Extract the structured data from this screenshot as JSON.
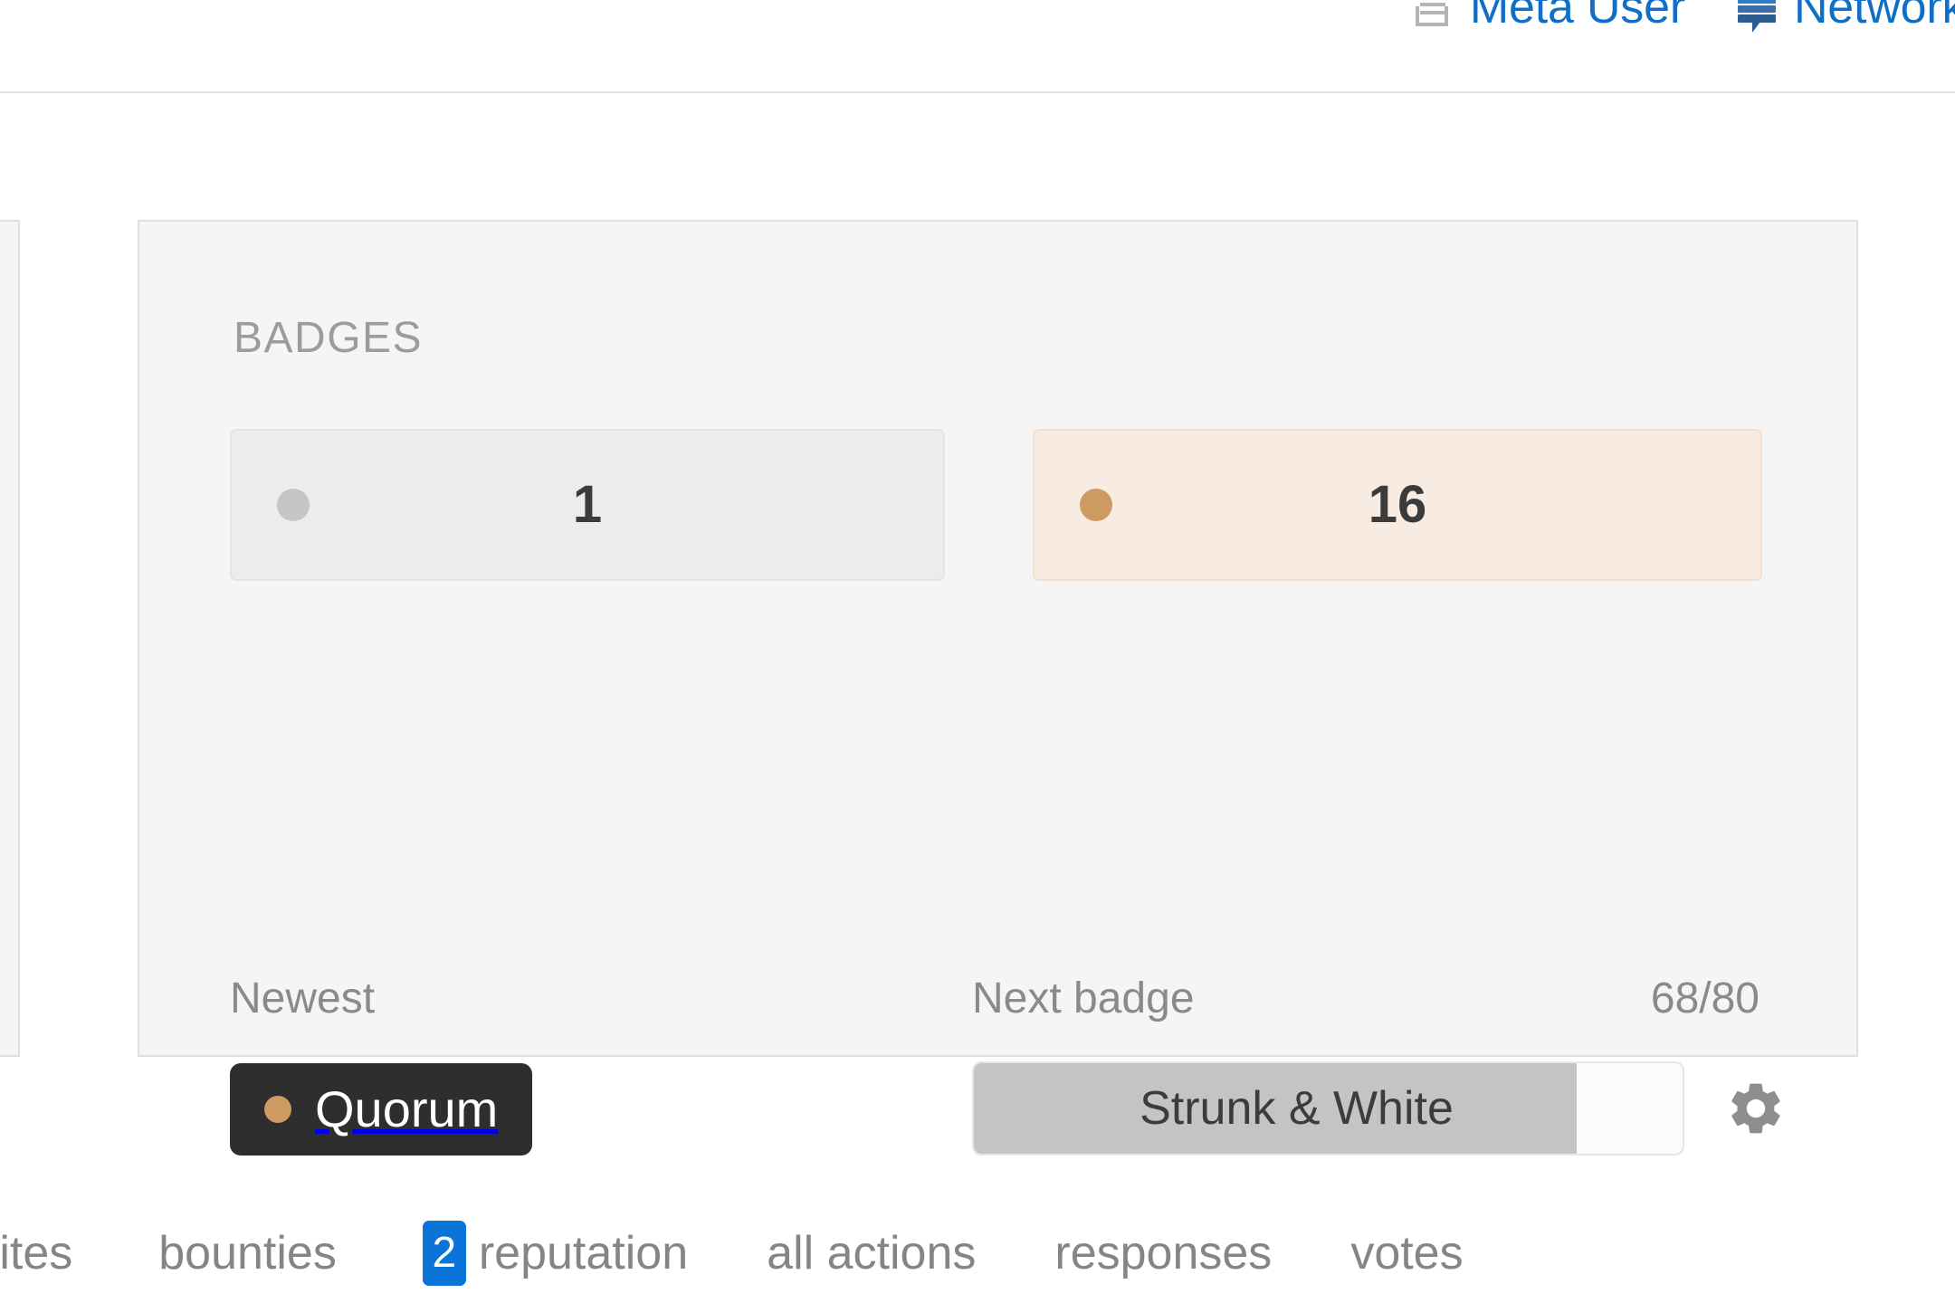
{
  "header": {
    "links": [
      {
        "icon": "meta-user-icon",
        "label": "Meta User"
      },
      {
        "icon": "network-profile-icon",
        "label": "Network P"
      }
    ]
  },
  "badges_card": {
    "heading": "BADGES",
    "counts": [
      {
        "tier": "silver",
        "dot_color": "#c5c5c5",
        "bg_color": "#eaecee",
        "value": "1"
      },
      {
        "tier": "bronze",
        "dot_color": "#cd9a62",
        "bg_color": "#f8ebe1",
        "value": "16"
      }
    ],
    "newest": {
      "label": "Newest",
      "badge_name": "Quorum",
      "badge_tier_color": "#cd9a62",
      "pill_bg": "#2e2e2e"
    },
    "next_badge": {
      "label": "Next badge",
      "progress_text": "68/80",
      "current": 68,
      "target": 80,
      "percent": 85,
      "name": "Strunk & White",
      "settings_icon": "gear-icon"
    }
  },
  "bottom_nav": {
    "tabs": [
      {
        "label": "rites",
        "count": null,
        "truncated": true
      },
      {
        "label": "bounties",
        "count": null
      },
      {
        "label": "reputation",
        "count": "2"
      },
      {
        "label": "all actions",
        "count": null
      },
      {
        "label": "responses",
        "count": null
      },
      {
        "label": "votes",
        "count": null
      }
    ]
  },
  "colors": {
    "link_blue": "#0f6fc6",
    "badge_blue": "#0b74d8",
    "card_bg": "#f5f5f5",
    "card_border": "#e0e0e0",
    "muted_text": "#8a8a8a"
  }
}
